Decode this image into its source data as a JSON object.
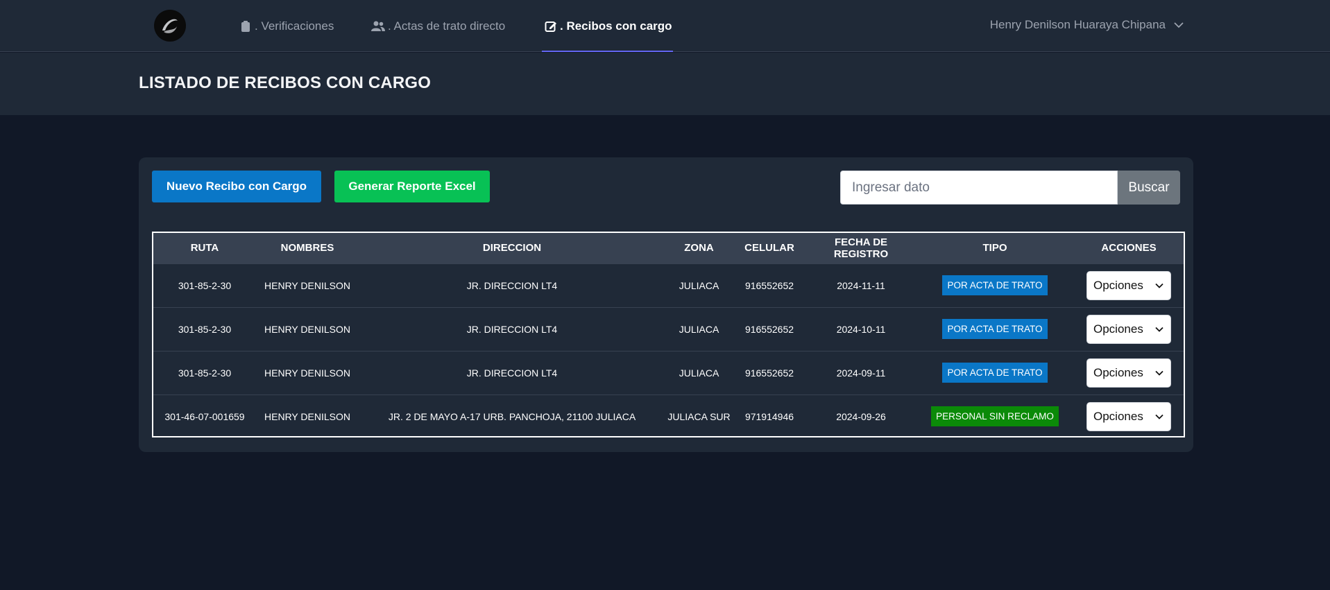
{
  "nav": {
    "links": [
      {
        "label": ". Verificaciones",
        "icon": "clipboard-icon"
      },
      {
        "label": ". Actas de trato directo",
        "icon": "users-icon"
      },
      {
        "label": ". Recibos con cargo",
        "icon": "edit-icon"
      }
    ],
    "active_index": 2,
    "user": "Henry Denilson Huaraya Chipana"
  },
  "header": {
    "title": "LISTADO DE RECIBOS CON CARGO"
  },
  "toolbar": {
    "new_label": "Nuevo Recibo con Cargo",
    "report_label": "Generar Reporte Excel",
    "search_placeholder": "Ingresar dato",
    "search_label": "Buscar"
  },
  "table": {
    "headers": [
      "RUTA",
      "NOMBRES",
      "DIRECCION",
      "ZONA",
      "CELULAR",
      "FECHA DE REGISTRO",
      "TIPO",
      "ACCIONES"
    ],
    "rows": [
      {
        "ruta": "301-85-2-30",
        "nombres": "HENRY DENILSON",
        "direccion": "JR. DIRECCION LT4",
        "zona": "JULIACA",
        "celular": "916552652",
        "fecha": "2024-11-11",
        "tipo": "POR ACTA DE TRATO",
        "accion": "Opciones"
      },
      {
        "ruta": "301-85-2-30",
        "nombres": "HENRY DENILSON",
        "direccion": "JR. DIRECCION LT4",
        "zona": "JULIACA",
        "celular": "916552652",
        "fecha": "2024-10-11",
        "tipo": "POR ACTA DE TRATO",
        "accion": "Opciones"
      },
      {
        "ruta": "301-85-2-30",
        "nombres": "HENRY DENILSON",
        "direccion": "JR. DIRECCION LT4",
        "zona": "JULIACA",
        "celular": "916552652",
        "fecha": "2024-09-11",
        "tipo": "POR ACTA DE TRATO",
        "accion": "Opciones"
      },
      {
        "ruta": "301-46-07-001659",
        "nombres": "HENRY DENILSON",
        "direccion": "JR. 2 DE MAYO A-17 URB. PANCHOJA, 21100 JULIACA",
        "zona": "JULIACA SUR",
        "celular": "971914946",
        "fecha": "2024-09-26",
        "tipo": "PERSONAL SIN RECLAMO",
        "accion": "Opciones"
      }
    ]
  },
  "colors": {
    "accent": "#6366f1",
    "primary_button": "#0a77c7",
    "success_button": "#08c155",
    "badge_acta": "#0a77c7",
    "badge_personal": "#0b8a08"
  }
}
